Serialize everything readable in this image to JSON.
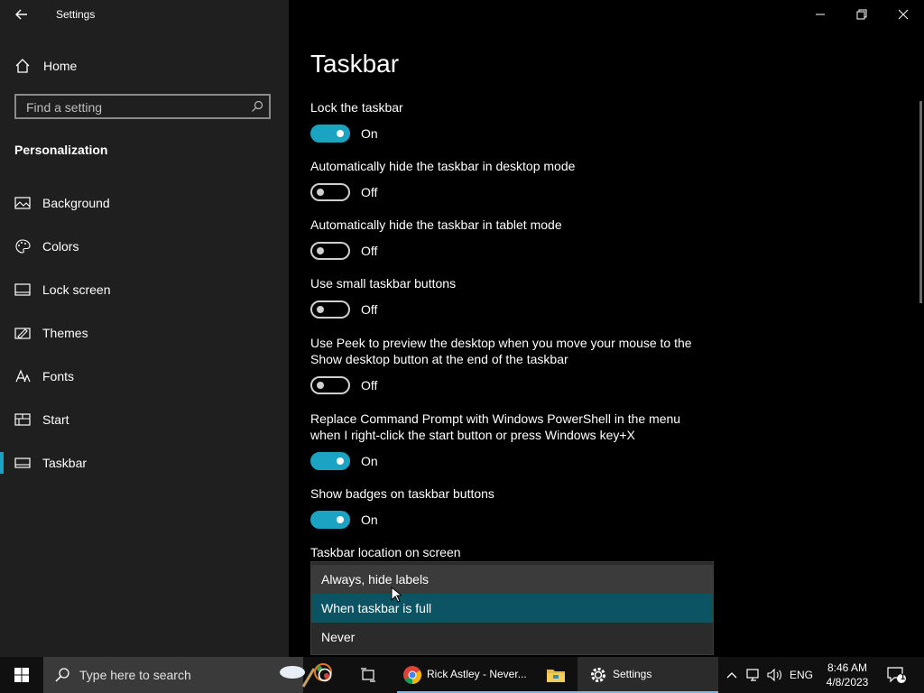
{
  "window": {
    "title": "Settings"
  },
  "sidebar": {
    "home_label": "Home",
    "search_placeholder": "Find a setting",
    "section_title": "Personalization",
    "items": [
      {
        "label": "Background",
        "icon": "picture-icon"
      },
      {
        "label": "Colors",
        "icon": "palette-icon"
      },
      {
        "label": "Lock screen",
        "icon": "lock-screen-icon"
      },
      {
        "label": "Themes",
        "icon": "themes-icon"
      },
      {
        "label": "Fonts",
        "icon": "fonts-icon"
      },
      {
        "label": "Start",
        "icon": "start-icon"
      },
      {
        "label": "Taskbar",
        "icon": "taskbar-icon",
        "active": true
      }
    ]
  },
  "main": {
    "title": "Taskbar",
    "settings": [
      {
        "label": "Lock the taskbar",
        "state": "On"
      },
      {
        "label": "Automatically hide the taskbar in desktop mode",
        "state": "Off"
      },
      {
        "label": "Automatically hide the taskbar in tablet mode",
        "state": "Off"
      },
      {
        "label": "Use small taskbar buttons",
        "state": "Off"
      },
      {
        "label": "Use Peek to preview the desktop when you move your mouse to the Show desktop button at the end of the taskbar",
        "state": "Off"
      },
      {
        "label": "Replace Command Prompt with Windows PowerShell in the menu when I right-click the start button or press Windows key+X",
        "state": "On"
      },
      {
        "label": "Show badges on taskbar buttons",
        "state": "On"
      }
    ],
    "location_label": "Taskbar location on screen",
    "dropdown_options": [
      "Always, hide labels",
      "When taskbar is full",
      "Never"
    ],
    "dropdown_selected": "When taskbar is full"
  },
  "taskbar": {
    "search_text": "Type here to search",
    "apps": [
      {
        "label": "Rick Astley - Never...",
        "icon": "chrome-icon"
      },
      {
        "label": "",
        "icon": "file-explorer-icon"
      },
      {
        "label": "Settings",
        "icon": "gear-icon",
        "active": true
      }
    ],
    "language": "ENG",
    "time": "8:46 AM",
    "date": "4/8/2023",
    "notification_count": "1"
  },
  "colors": {
    "accent": "#1aa3c3",
    "selected_option": "#0c5464"
  }
}
